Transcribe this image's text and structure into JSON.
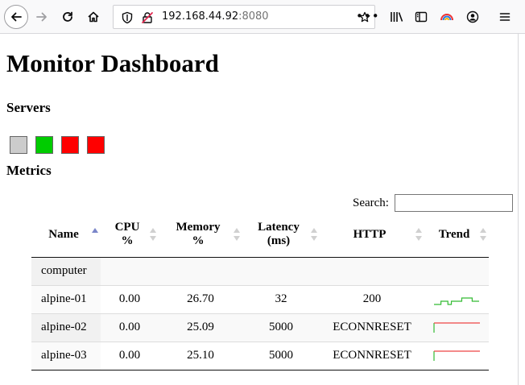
{
  "browser": {
    "url_host": "192.168.44.92",
    "url_port": ":8080",
    "page_actions_label": "•••"
  },
  "page": {
    "title": "Monitor Dashboard",
    "servers_heading": "Servers",
    "metrics_heading": "Metrics"
  },
  "servers": [
    {
      "status": "unknown",
      "color": "#cccccc"
    },
    {
      "status": "up",
      "color": "#00cc00"
    },
    {
      "status": "down",
      "color": "#ff0000"
    },
    {
      "status": "down",
      "color": "#ff0000"
    }
  ],
  "search": {
    "label": "Search:",
    "value": ""
  },
  "table": {
    "columns": [
      {
        "label": "Name",
        "sort": "asc"
      },
      {
        "label": "CPU\n%",
        "sort": "none"
      },
      {
        "label": "Memory\n%",
        "sort": "none"
      },
      {
        "label": "Latency\n(ms)",
        "sort": "none"
      },
      {
        "label": "HTTP",
        "sort": "none"
      },
      {
        "label": "Trend",
        "sort": "none"
      }
    ],
    "rows": [
      {
        "name": "computer",
        "cpu": "",
        "memory": "",
        "latency": "",
        "http": "",
        "trend": []
      },
      {
        "name": "alpine-01",
        "cpu": "0.00",
        "memory": "26.70",
        "latency": "32",
        "http": "200",
        "trend": [
          0,
          0,
          1,
          1,
          0,
          1,
          1,
          1,
          2,
          2,
          2,
          1,
          1
        ]
      },
      {
        "name": "alpine-02",
        "cpu": "0.00",
        "memory": "25.09",
        "latency": "5000",
        "http": "ECONNRESET",
        "trend": [
          0,
          3,
          3,
          3,
          3,
          3,
          3,
          3,
          3,
          3,
          3,
          3,
          3
        ]
      },
      {
        "name": "alpine-03",
        "cpu": "0.00",
        "memory": "25.10",
        "latency": "5000",
        "http": "ECONNRESET",
        "trend": [
          0,
          3,
          3,
          3,
          3,
          3,
          3,
          3,
          3,
          3,
          3,
          3,
          3
        ]
      }
    ]
  },
  "colors": {
    "trend_ok": "#33bb33",
    "trend_bad": "#ee4444"
  }
}
